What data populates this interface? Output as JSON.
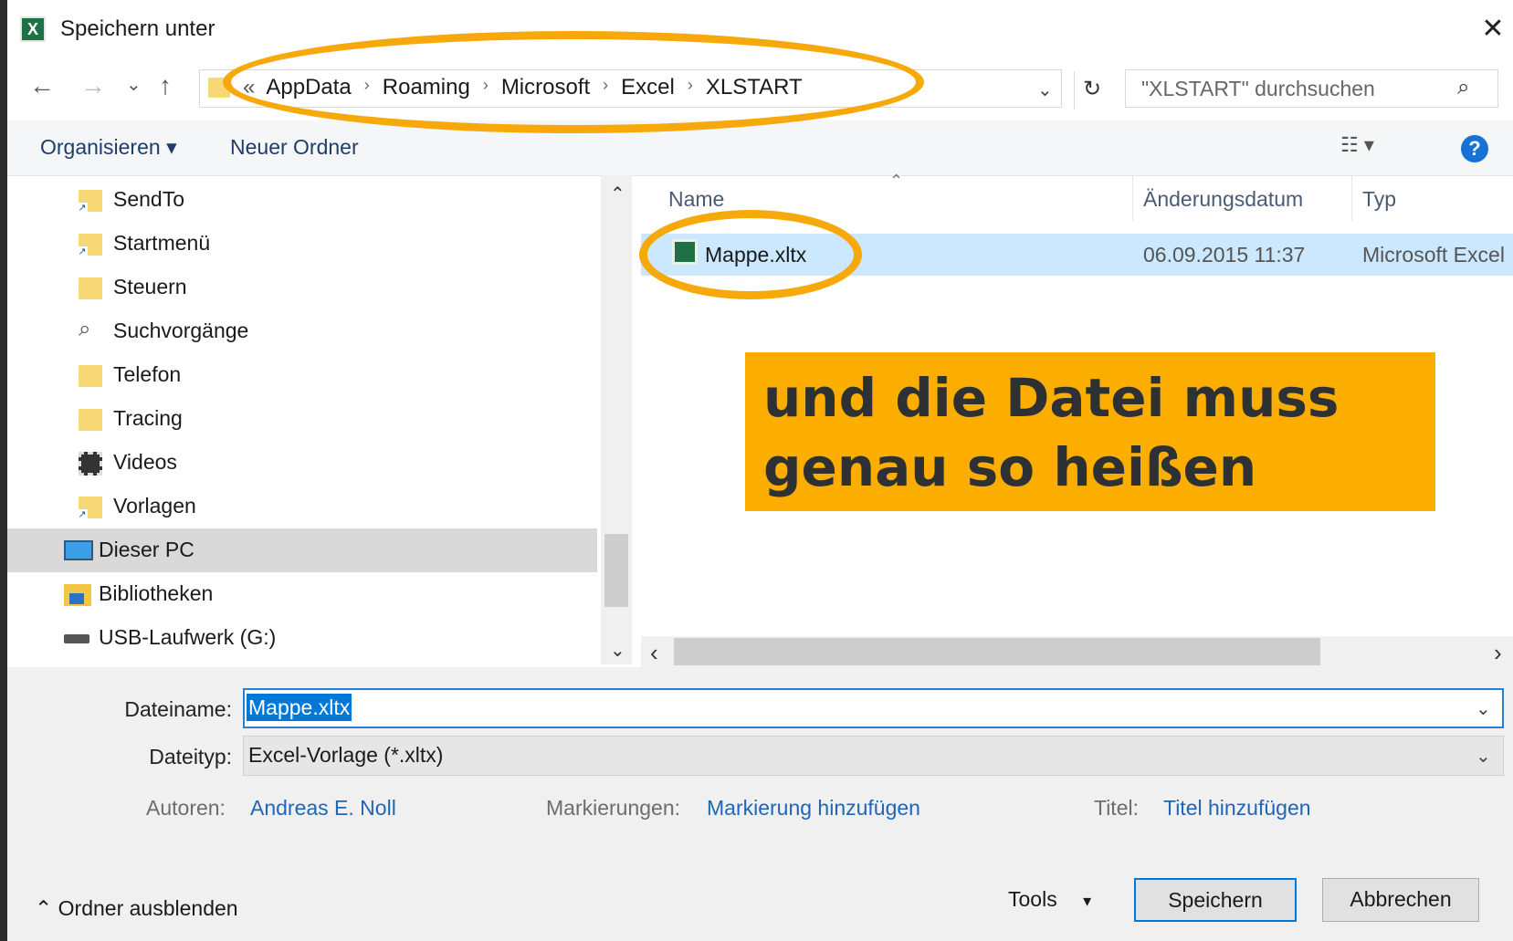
{
  "window": {
    "title": "Speichern unter",
    "app_icon": "excel-icon",
    "close": "✕"
  },
  "nav": {
    "back": "←",
    "forward": "→",
    "recent": "⌄",
    "up": "↑",
    "breadcrumbs": [
      "«",
      "AppData",
      "Roaming",
      "Microsoft",
      "Excel",
      "XLSTART"
    ],
    "separator": "›",
    "refresh": "↻",
    "dropdown": "⌄",
    "search_placeholder": "\"XLSTART\" durchsuchen"
  },
  "toolbar": {
    "organize": "Organisieren ▾",
    "new_folder": "Neuer Ordner",
    "view": "☷ ▾",
    "help": "?"
  },
  "sidebar": {
    "items": [
      {
        "label": "SendTo",
        "icon": "folder-shortcut-icon"
      },
      {
        "label": "Startmenü",
        "icon": "folder-shortcut-icon"
      },
      {
        "label": "Steuern",
        "icon": "folder-icon"
      },
      {
        "label": "Suchvorgänge",
        "icon": "search-icon"
      },
      {
        "label": "Telefon",
        "icon": "folder-icon"
      },
      {
        "label": "Tracing",
        "icon": "folder-icon"
      },
      {
        "label": "Videos",
        "icon": "video-folder-icon"
      },
      {
        "label": "Vorlagen",
        "icon": "folder-shortcut-icon"
      },
      {
        "label": "Dieser PC",
        "icon": "computer-icon",
        "selected": true
      },
      {
        "label": "Bibliotheken",
        "icon": "library-icon"
      },
      {
        "label": "USB-Laufwerk (G:)",
        "icon": "usb-drive-icon"
      }
    ],
    "scroll_up": "⌃",
    "scroll_down": "⌄"
  },
  "files": {
    "columns": [
      "Name",
      "Änderungsdatum",
      "Typ"
    ],
    "sort_indicator": "⌃",
    "rows": [
      {
        "name": "Mappe.xltx",
        "date": "06.09.2015 11:37",
        "type": "Microsoft Excel"
      }
    ],
    "scroll_left": "‹",
    "scroll_right": "›"
  },
  "annotation": {
    "callout_line1": "und die Datei muss",
    "callout_line2": "genau so heißen",
    "highlight_color": "#f7a90b"
  },
  "form": {
    "filename_label": "Dateiname:",
    "filename_value": "Mappe.xltx",
    "filetype_label": "Dateityp:",
    "filetype_value": "Excel-Vorlage (*.xltx)",
    "authors_label": "Autoren:",
    "authors_value": "Andreas E. Noll",
    "tags_label": "Markierungen:",
    "tags_value": "Markierung hinzufügen",
    "title_label": "Titel:",
    "title_value": "Titel hinzufügen",
    "dropdown": "⌄"
  },
  "footer": {
    "hide_folders": "⌃  Ordner ausblenden",
    "tools": "Tools",
    "tools_arrow": "▾",
    "save": "Speichern",
    "cancel": "Abbrechen"
  }
}
